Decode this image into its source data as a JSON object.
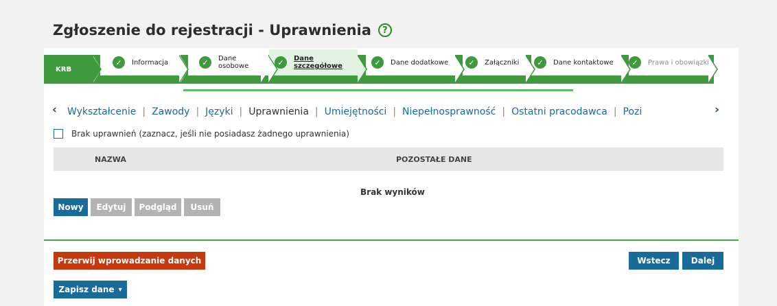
{
  "page": {
    "title": "Zgłoszenie do rejestracji - Uprawnienia",
    "help_symbol": "?"
  },
  "stepper": {
    "first": "KRB",
    "steps": [
      {
        "label": "Informacja",
        "state": "done"
      },
      {
        "label": "Dane osobowe",
        "state": "done"
      },
      {
        "label": "Dane szczegółowe",
        "state": "active"
      },
      {
        "label": "Dane dodatkowe",
        "state": "done"
      },
      {
        "label": "Załączniki",
        "state": "done"
      },
      {
        "label": "Dane kontaktowe",
        "state": "done"
      },
      {
        "label": "Prawa i obowiązki",
        "state": "dim"
      }
    ],
    "check_symbol": "✓"
  },
  "tabs": {
    "left_arrow": "‹",
    "right_arrow": "›",
    "items": [
      "Wykształcenie",
      "Zawody",
      "Języki",
      "Uprawnienia",
      "Umiejętności",
      "Niepełnosprawność",
      "Ostatni pracodawca",
      "Pozi"
    ],
    "separator": "|"
  },
  "checkbox": {
    "label": "Brak uprawnień (zaznacz, jeśli nie posiadasz żadnego uprawnienia)",
    "checked": false
  },
  "table": {
    "columns": [
      "NAZWA",
      "POZOSTAŁE DANE"
    ],
    "empty_message": "Brak wyników"
  },
  "actions": {
    "new": "Nowy",
    "edit": "Edytuj",
    "preview": "Podgląd",
    "delete": "Usuń"
  },
  "footer": {
    "abort": "Przerwij wprowadzanie danych",
    "back": "Wstecz",
    "next": "Dalej",
    "save": "Zapisz dane",
    "save_caret": "▾"
  },
  "colors": {
    "green": "#3f9a3f",
    "blue": "#1a6a9a",
    "red": "#c43a10",
    "gray": "#b3b3b3"
  }
}
